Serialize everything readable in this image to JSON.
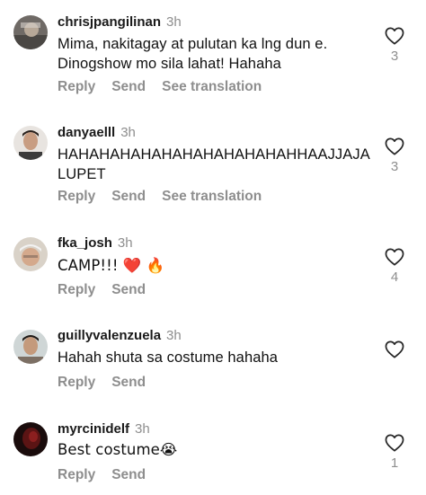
{
  "comments": [
    {
      "username": "chrisjpangilinan",
      "time": "3h",
      "text": "Mima, nakitagay at pulutan ka lng dun e. Dinogshow mo sila lahat! Hahaha",
      "reply": "Reply",
      "send": "Send",
      "translate": "See translation",
      "likes": "3"
    },
    {
      "username": "danyaelll",
      "time": "3h",
      "text": "HAHAHAHAHAHAHAHAHAHAHAHHAAJJAJA LUPET",
      "reply": "Reply",
      "send": "Send",
      "translate": "See translation",
      "likes": "3"
    },
    {
      "username": "fka_josh",
      "time": "3h",
      "text": "CAMP!!! ❤️ 🔥",
      "reply": "Reply",
      "send": "Send",
      "likes": "4"
    },
    {
      "username": "guillyvalenzuela",
      "time": "3h",
      "text": "Hahah shuta sa costume hahaha",
      "reply": "Reply",
      "send": "Send"
    },
    {
      "username": "myrcinidelf",
      "time": "3h",
      "text": "Best costume😭",
      "reply": "Reply",
      "send": "Send",
      "likes": "1"
    }
  ],
  "icons": {
    "like": "heart-outline-icon"
  },
  "colors": {
    "text": "#111111",
    "secondary": "#8e8e8e",
    "heart_stroke": "#262626"
  }
}
